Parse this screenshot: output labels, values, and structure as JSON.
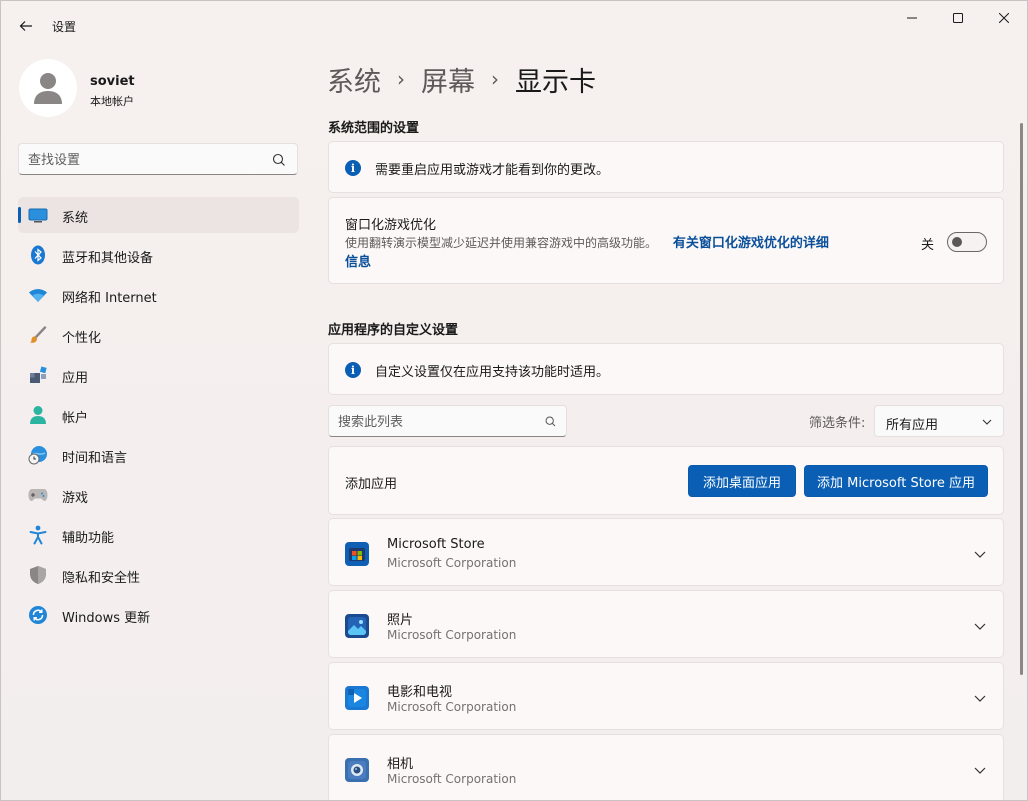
{
  "window": {
    "title": "设置"
  },
  "profile": {
    "name": "soviet",
    "account_type": "本地帐户"
  },
  "sidebar": {
    "search_placeholder": "查找设置",
    "items": [
      {
        "label": "系统",
        "icon": "system-icon",
        "active": true
      },
      {
        "label": "蓝牙和其他设备",
        "icon": "bluetooth-icon"
      },
      {
        "label": "网络和 Internet",
        "icon": "wifi-icon"
      },
      {
        "label": "个性化",
        "icon": "brush-icon"
      },
      {
        "label": "应用",
        "icon": "apps-icon"
      },
      {
        "label": "帐户",
        "icon": "account-icon"
      },
      {
        "label": "时间和语言",
        "icon": "globe-clock-icon"
      },
      {
        "label": "游戏",
        "icon": "gamepad-icon"
      },
      {
        "label": "辅助功能",
        "icon": "accessibility-icon"
      },
      {
        "label": "隐私和安全性",
        "icon": "shield-icon"
      },
      {
        "label": "Windows 更新",
        "icon": "update-icon"
      }
    ]
  },
  "breadcrumb": {
    "items": [
      "系统",
      "屏幕",
      "显示卡"
    ],
    "separator": "›"
  },
  "system_settings": {
    "title": "系统范围的设置",
    "restart_info": "需要重启应用或游戏才能看到你的更改。",
    "windowed_opt": {
      "title": "窗口化游戏优化",
      "description": "使用翻转演示模型减少延迟并使用兼容游戏中的高级功能。",
      "link_line1": "有关窗口化游戏优化的详细",
      "link_line2": "信息",
      "toggle_label": "关",
      "toggle_on": false
    }
  },
  "app_settings": {
    "title": "应用程序的自定义设置",
    "info": "自定义设置仅在应用支持该功能时适用。",
    "search_placeholder": "搜索此列表",
    "filter_label": "筛选条件:",
    "filter_value": "所有应用",
    "add_label": "添加应用",
    "add_desktop_button": "添加桌面应用",
    "add_store_button": "添加 Microsoft Store 应用",
    "apps": [
      {
        "name": "Microsoft Store",
        "publisher": "Microsoft Corporation",
        "icon": "store-icon"
      },
      {
        "name": "照片",
        "publisher": "Microsoft Corporation",
        "icon": "photos-icon"
      },
      {
        "name": "电影和电视",
        "publisher": "Microsoft Corporation",
        "icon": "movies-icon"
      },
      {
        "name": "相机",
        "publisher": "Microsoft Corporation",
        "icon": "camera-icon"
      }
    ]
  },
  "colors": {
    "accent": "#0a5fb5",
    "link": "#0a4f9a",
    "background": "#f4eeeb",
    "card": "#fbf8f7"
  }
}
